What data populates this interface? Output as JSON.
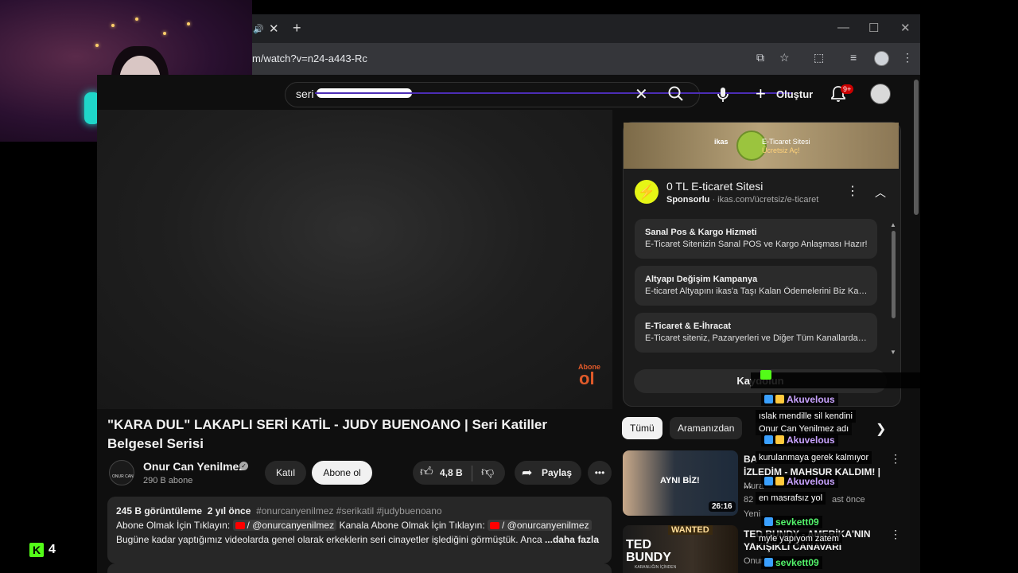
{
  "browser": {
    "url": "m/watch?v=n24-a443-Rc",
    "tab_close": "✕",
    "new_tab": "+"
  },
  "search": {
    "value": "seri"
  },
  "header": {
    "create_label": "Oluştur",
    "notif_count": "9+"
  },
  "video": {
    "watermark_top": "Abone",
    "watermark_main": "ol",
    "title": "\"KARA DUL\" LAKAPLI SERİ KATİL - JUDY BUENOANO | Seri Katiller Belgesel Serisi",
    "channel_name": "Onur Can Yenilmez",
    "subscribers": "290 B abone",
    "join_label": "Katıl",
    "subscribe_label": "Abone ol",
    "likes": "4,8 B",
    "share_label": "Paylaş",
    "logo_text": "ONUR CAN"
  },
  "description": {
    "views": "245 B görüntüleme",
    "age": "2 yıl önce",
    "tags": "#onurcanyenilmez #serikatil #judybuenoano",
    "line2_a": "Abone Olmak İçin Tıklayın:",
    "handle": "/ @onurcanyenilmez",
    "line2_b": "Kanala Abone Olmak İçin Tıklayın:",
    "line3": "Bugüne kadar yaptığımız videolarda genel olarak erkeklerin seri cinayetler işlediğini görmüştük. Anca",
    "more": "...daha fazla"
  },
  "ad": {
    "banner_brand": "ikas",
    "banner_line1": "E-Ticaret Sitesi",
    "banner_line2": "Ücretsiz Aç!",
    "icon": "⚡",
    "title": "0 TL E-ticaret Sitesi",
    "sponsored": "Sponsorlu",
    "domain": "· ikas.com/ücretsiz/e-ticaret",
    "items": [
      {
        "heading": "Sanal Pos & Kargo Hizmeti",
        "desc": "E-Ticaret Sitenizin Sanal POS ve Kargo Anlaşması Hazır!"
      },
      {
        "heading": "Altyapı Değişim Kampanya",
        "desc": "E-ticaret Altyapını ikas'a Taşı Kalan Ödemelerini Biz Karşıla..."
      },
      {
        "heading": "E-Ticaret & E-İhracat",
        "desc": "E-Ticaret siteniz, Pazaryerleri ve Diğer Tüm Kanallardan Sat..."
      }
    ],
    "cta": "Kaydolun"
  },
  "chips": [
    "Tümü",
    "Aramanızdan"
  ],
  "recommended": [
    {
      "title_1": "BA",
      "title_2": "İZLEDİM - MAHSUR KALDIM! | ...",
      "channel": "Mura",
      "meta": "82",
      "age": "ast önce",
      "extra": "Yeni",
      "duration": "26:16",
      "thumb_text": "AYNI BİZ!"
    },
    {
      "title_1": "TED BUNDY - AMERİKA'NIN",
      "title_2": "YAKIŞIKLI CANAVARI",
      "channel": "Onur",
      "thumb_text": "TED BUNDY",
      "thumb_sub": "KARANLIĞIN İÇİNDEN",
      "thumb_banner": "WANTED"
    }
  ],
  "stream": {
    "viewer_count": "4",
    "kick_mark": "K",
    "chat": [
      {
        "user": "Akuvelous",
        "user_color": "#c9a3ff",
        "msg": "ıslak mendille sil kendini"
      },
      {
        "user": "Akuvelous",
        "user_color": "#c9a3ff",
        "msg": "kurulanmaya gerek kalmıyor"
      },
      {
        "user": "Akuvelous",
        "user_color": "#c9a3ff",
        "msg": "en masrafsız yol"
      },
      {
        "user": "sevkett09",
        "user_color": "#52f26a",
        "msg": "myle yapıyom zatem"
      },
      {
        "user": "sevkett09",
        "user_color": "#52f26a",
        "msg": ""
      }
    ],
    "overlap_text": "Onur Can Yenilmez adı"
  }
}
